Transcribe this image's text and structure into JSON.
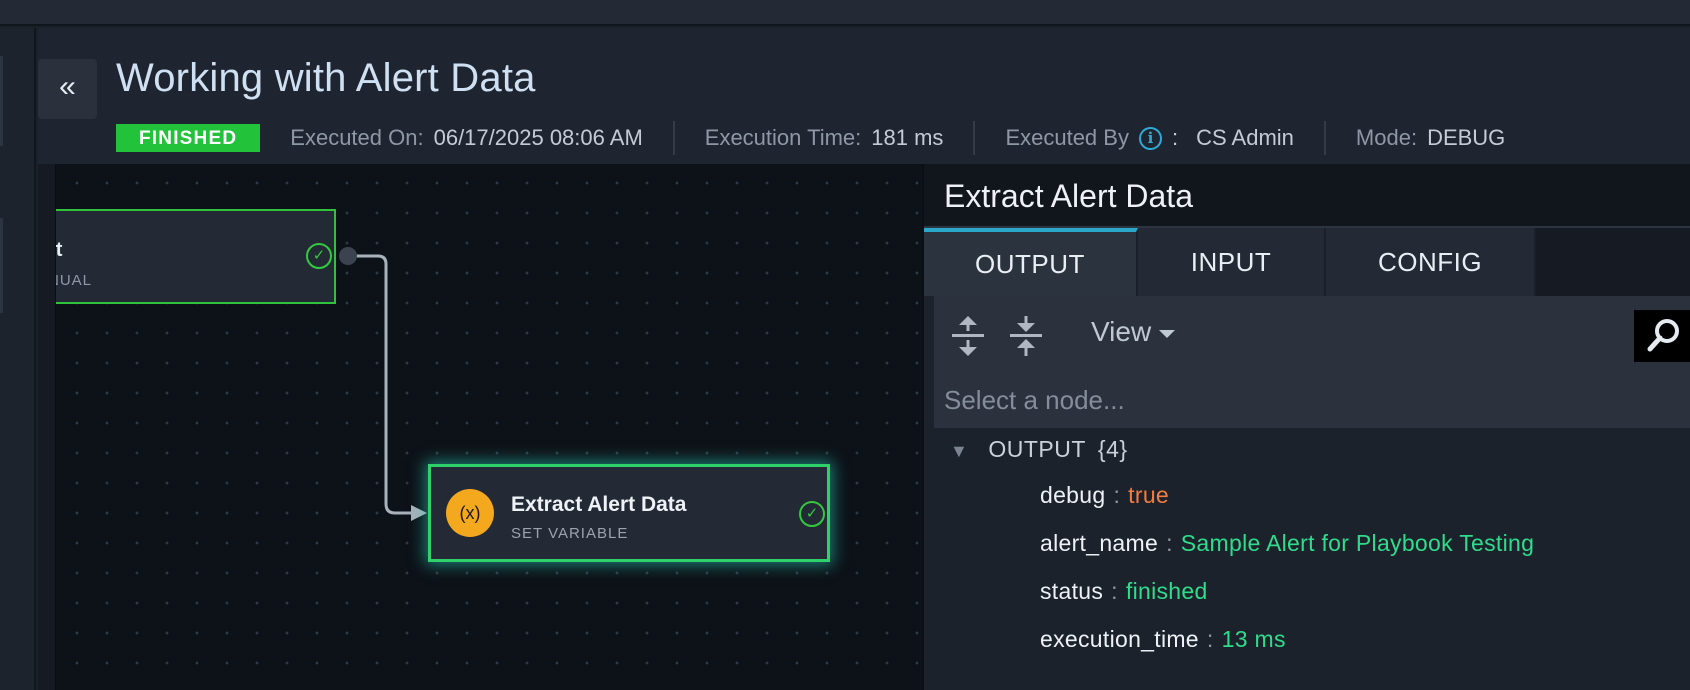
{
  "header": {
    "collapse_label": "«",
    "title": "Working with Alert Data",
    "status": "FINISHED",
    "executed_on_label": "Executed On:",
    "executed_on": "06/17/2025 08:06 AM",
    "execution_time_label": "Execution Time:",
    "execution_time": "181 ms",
    "executed_by_label": "Executed By",
    "executed_by_sep": ":",
    "executed_by": "CS Admin",
    "mode_label": "Mode:",
    "mode": "DEBUG",
    "info_glyph": "i"
  },
  "canvas": {
    "start_node": {
      "title": "rt",
      "subtitle": "NUAL",
      "status_icon": "check-circle-icon"
    },
    "extract_node": {
      "title": "Extract Alert Data",
      "subtitle": "SET VARIABLE",
      "icon_text": "(x)",
      "status_icon": "check-circle-icon"
    }
  },
  "panel": {
    "title": "Extract Alert Data",
    "tabs": [
      {
        "label": "OUTPUT",
        "active": true
      },
      {
        "label": "INPUT",
        "active": false
      },
      {
        "label": "CONFIG",
        "active": false
      }
    ],
    "toolbar": {
      "view_label": "View"
    },
    "node_select_placeholder": "Select a node...",
    "tree": {
      "root_label": "OUTPUT",
      "root_count": "{4}",
      "entries": [
        {
          "key": "debug",
          "value": "true",
          "type": "bool"
        },
        {
          "key": "alert_name",
          "value": "Sample Alert for Playbook Testing",
          "type": "string"
        },
        {
          "key": "status",
          "value": "finished",
          "type": "string"
        },
        {
          "key": "execution_time",
          "value": "13 ms",
          "type": "string"
        }
      ]
    }
  },
  "colors": {
    "status_finished": "#22c33a",
    "accent_tab": "#2ba8c9",
    "bool_value": "#f47c3f",
    "string_value": "#2fdc8c",
    "var_icon": "#f4a81d"
  }
}
